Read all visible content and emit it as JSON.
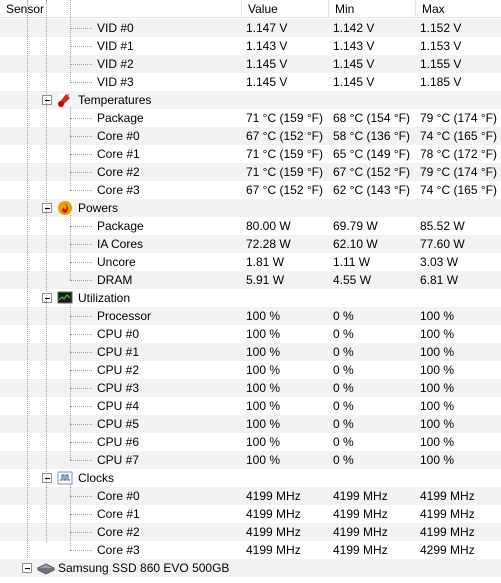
{
  "columns": {
    "sensor": "Sensor",
    "value": "Value",
    "min": "Min",
    "max": "Max"
  },
  "vid_rows": [
    {
      "name": "VID #0",
      "value": "1.147 V",
      "min": "1.142 V",
      "max": "1.152 V"
    },
    {
      "name": "VID #1",
      "value": "1.143 V",
      "min": "1.143 V",
      "max": "1.153 V"
    },
    {
      "name": "VID #2",
      "value": "1.145 V",
      "min": "1.145 V",
      "max": "1.155 V"
    },
    {
      "name": "VID #3",
      "value": "1.145 V",
      "min": "1.145 V",
      "max": "1.185 V"
    }
  ],
  "temperatures": {
    "label": "Temperatures",
    "rows": [
      {
        "name": "Package",
        "value": "71 °C  (159 °F)",
        "min": "68 °C  (154 °F)",
        "max": "79 °C  (174 °F)"
      },
      {
        "name": "Core #0",
        "value": "67 °C  (152 °F)",
        "min": "58 °C  (136 °F)",
        "max": "74 °C  (165 °F)"
      },
      {
        "name": "Core #1",
        "value": "71 °C  (159 °F)",
        "min": "65 °C  (149 °F)",
        "max": "78 °C  (172 °F)"
      },
      {
        "name": "Core #2",
        "value": "71 °C  (159 °F)",
        "min": "67 °C  (152 °F)",
        "max": "79 °C  (174 °F)"
      },
      {
        "name": "Core #3",
        "value": "67 °C  (152 °F)",
        "min": "62 °C  (143 °F)",
        "max": "74 °C  (165 °F)"
      }
    ]
  },
  "powers": {
    "label": "Powers",
    "rows": [
      {
        "name": "Package",
        "value": "80.00 W",
        "min": "69.79 W",
        "max": "85.52 W"
      },
      {
        "name": "IA Cores",
        "value": "72.28 W",
        "min": "62.10 W",
        "max": "77.60 W"
      },
      {
        "name": "Uncore",
        "value": "1.81 W",
        "min": "1.11 W",
        "max": "3.03 W"
      },
      {
        "name": "DRAM",
        "value": "5.91 W",
        "min": "4.55 W",
        "max": "6.81 W"
      }
    ]
  },
  "utilization": {
    "label": "Utilization",
    "rows": [
      {
        "name": "Processor",
        "value": "100 %",
        "min": "0 %",
        "max": "100 %"
      },
      {
        "name": "CPU #0",
        "value": "100 %",
        "min": "0 %",
        "max": "100 %"
      },
      {
        "name": "CPU #1",
        "value": "100 %",
        "min": "0 %",
        "max": "100 %"
      },
      {
        "name": "CPU #2",
        "value": "100 %",
        "min": "0 %",
        "max": "100 %"
      },
      {
        "name": "CPU #3",
        "value": "100 %",
        "min": "0 %",
        "max": "100 %"
      },
      {
        "name": "CPU #4",
        "value": "100 %",
        "min": "0 %",
        "max": "100 %"
      },
      {
        "name": "CPU #5",
        "value": "100 %",
        "min": "0 %",
        "max": "100 %"
      },
      {
        "name": "CPU #6",
        "value": "100 %",
        "min": "0 %",
        "max": "100 %"
      },
      {
        "name": "CPU #7",
        "value": "100 %",
        "min": "0 %",
        "max": "100 %"
      }
    ]
  },
  "clocks": {
    "label": "Clocks",
    "rows": [
      {
        "name": "Core #0",
        "value": "4199 MHz",
        "min": "4199 MHz",
        "max": "4199 MHz"
      },
      {
        "name": "Core #1",
        "value": "4199 MHz",
        "min": "4199 MHz",
        "max": "4199 MHz"
      },
      {
        "name": "Core #2",
        "value": "4199 MHz",
        "min": "4199 MHz",
        "max": "4199 MHz"
      },
      {
        "name": "Core #3",
        "value": "4199 MHz",
        "min": "4199 MHz",
        "max": "4299 MHz"
      }
    ]
  },
  "device": {
    "label": "Samsung SSD 860 EVO 500GB",
    "icon": "drive-icon"
  },
  "icons": {
    "temperatures": "thermometer-icon",
    "powers": "flame-icon",
    "utilization": "monitor-icon",
    "clocks": "clock-wave-icon"
  },
  "colors": {
    "row_shade": "#f2f2f2",
    "tree_line": "#a0a0a0",
    "header_border": "#e3e3e3"
  }
}
